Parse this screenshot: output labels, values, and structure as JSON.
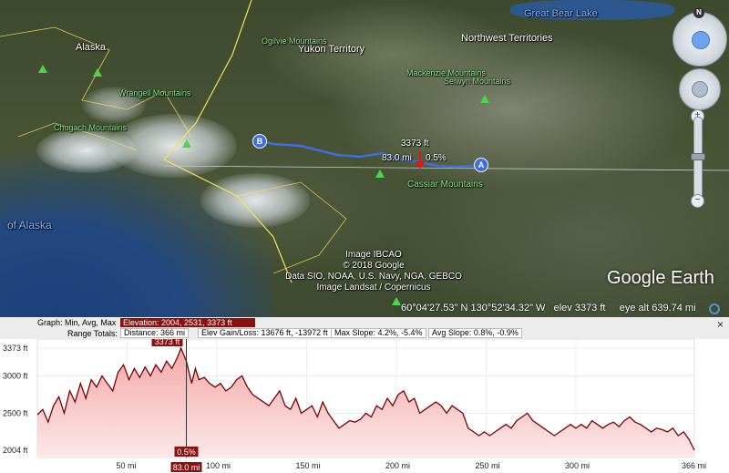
{
  "map": {
    "labels": {
      "great_bear_lake": "Great Bear Lake",
      "northwest_territories": "Northwest Territories",
      "yukon_territory": "Yukon Territory",
      "ogilvie": "Ogilvie Mountains",
      "mackenzie": "Mackenzie Mountains",
      "selwyn": "Selwyn Mountains",
      "alaska": "Alaska",
      "wrangell": "Wrangell Mountains",
      "chugach": "Chugach Mountains",
      "gulf": "of Alaska",
      "cassiar": "Cassiar Mountains"
    },
    "cursor_info": {
      "elev": "3373 ft",
      "dist": "83.0 mi",
      "slope": "0.5%"
    },
    "markers": {
      "a": "A",
      "b": "B"
    },
    "credits": [
      "Image IBCAO",
      "© 2018 Google",
      "Data SIO, NOAA, U.S. Navy, NGA, GEBCO",
      "Image Landsat / Copernicus"
    ],
    "logo": "Google Earth",
    "status": {
      "coords": "60°04'27.53\" N  130°52'34.32\" W",
      "elev": "elev  3373 ft",
      "eye_alt": "eye alt 639.74 mi"
    },
    "nav": {
      "north": "N",
      "zoom_in": "+",
      "zoom_out": "−"
    }
  },
  "panel": {
    "graph_label": "Graph: Min, Avg, Max",
    "elevation_label": "Elevation: 2004, 2531, 3373 ft",
    "range_label": "Range Totals:",
    "distance": "Distance: 366 mi",
    "gain_loss": "Elev Gain/Loss: 13676 ft, -13972 ft",
    "max_slope": "Max Slope: 4.2%, -5.4%",
    "avg_slope": "Avg Slope: 0.8%, -0.9%",
    "close": "×"
  },
  "chart_data": {
    "type": "area",
    "title": "",
    "xlabel": "",
    "ylabel": "",
    "xlim": [
      0,
      366
    ],
    "ylim": [
      2004,
      3373
    ],
    "y_ticks": [
      "3373 ft",
      "3000 ft",
      "2500 ft",
      "2004 ft"
    ],
    "y_tick_values": [
      3373,
      3000,
      2500,
      2004
    ],
    "x_ticks": [
      "50 mi",
      "100 mi",
      "150 mi",
      "200 mi",
      "250 mi",
      "300 mi",
      "366 mi"
    ],
    "x_tick_values": [
      50,
      100,
      150,
      200,
      250,
      300,
      366
    ],
    "cursor": {
      "x": 83.0,
      "x_label": "83.0 mi",
      "y": 3373,
      "y_label": "3373 ft",
      "slope_label": "0.5%"
    },
    "colors": {
      "line": "#7a0000",
      "fill_top": "#f4a8a8",
      "fill_bottom": "#fde8e8",
      "cursor": "#8b1010"
    },
    "series": [
      {
        "x": [
          0,
          3,
          6,
          9,
          12,
          15,
          18,
          21,
          24,
          27,
          30,
          33,
          36,
          39,
          42,
          45,
          48,
          51,
          54,
          57,
          60,
          63,
          66,
          69,
          72,
          75,
          78,
          80,
          83,
          86,
          88,
          90,
          93,
          96,
          99,
          102,
          105,
          108,
          111,
          114,
          117,
          120,
          123,
          126,
          129,
          132,
          135,
          138,
          141,
          144,
          147,
          150,
          153,
          156,
          159,
          162,
          165,
          168,
          171,
          174,
          177,
          180,
          183,
          186,
          189,
          192,
          195,
          198,
          201,
          204,
          207,
          210,
          213,
          216,
          219,
          222,
          225,
          228,
          231,
          234,
          237,
          240,
          243,
          246,
          249,
          252,
          255,
          258,
          261,
          264,
          267,
          270,
          273,
          276,
          279,
          282,
          285,
          288,
          291,
          294,
          297,
          300,
          303,
          306,
          309,
          312,
          315,
          318,
          321,
          324,
          327,
          330,
          333,
          336,
          339,
          342,
          345,
          348,
          351,
          354,
          357,
          360,
          363,
          366
        ],
        "y": [
          2480,
          2550,
          2380,
          2600,
          2720,
          2500,
          2800,
          2650,
          2900,
          2700,
          2950,
          2850,
          3000,
          2900,
          2800,
          3050,
          3150,
          2950,
          3100,
          2980,
          3120,
          3000,
          3150,
          3050,
          3200,
          3100,
          3250,
          3373,
          3200,
          2900,
          3100,
          2950,
          2980,
          2900,
          2850,
          2900,
          2800,
          2850,
          2950,
          3000,
          2850,
          2750,
          2700,
          2650,
          2600,
          2700,
          2800,
          2600,
          2550,
          2700,
          2500,
          2550,
          2600,
          2450,
          2650,
          2500,
          2400,
          2300,
          2350,
          2400,
          2380,
          2420,
          2500,
          2450,
          2600,
          2550,
          2700,
          2600,
          2750,
          2800,
          2650,
          2700,
          2500,
          2550,
          2600,
          2650,
          2600,
          2500,
          2600,
          2550,
          2500,
          2300,
          2250,
          2200,
          2250,
          2200,
          2250,
          2300,
          2350,
          2300,
          2400,
          2450,
          2500,
          2400,
          2350,
          2300,
          2250,
          2200,
          2250,
          2300,
          2350,
          2300,
          2350,
          2300,
          2400,
          2350,
          2300,
          2350,
          2380,
          2320,
          2400,
          2450,
          2380,
          2350,
          2300,
          2250,
          2300,
          2280,
          2250,
          2300,
          2200,
          2250,
          2150,
          2004
        ]
      }
    ]
  }
}
